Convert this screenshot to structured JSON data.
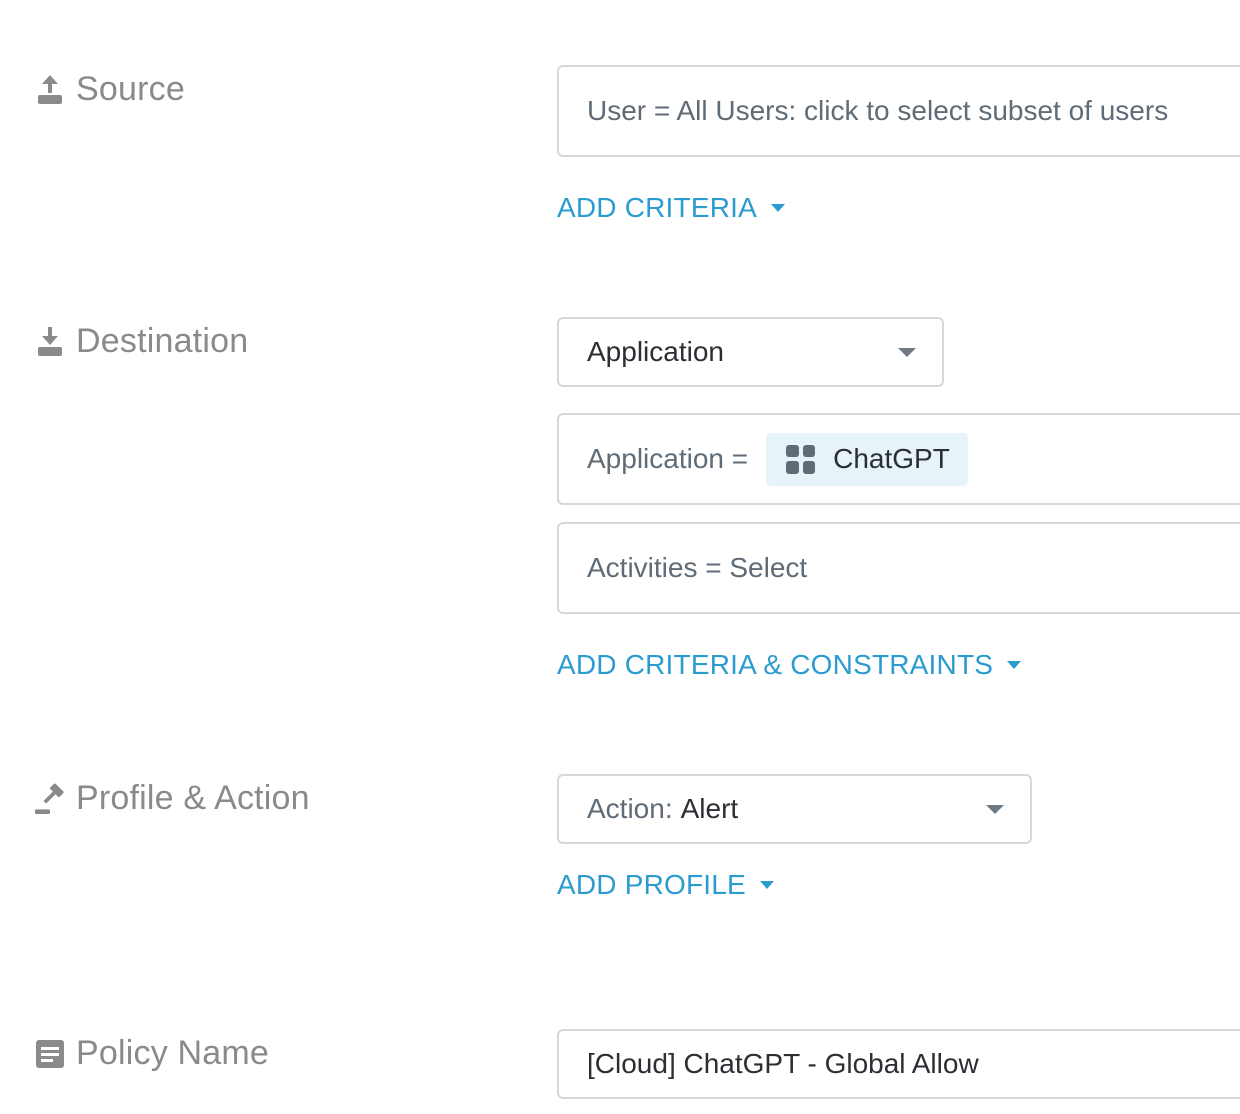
{
  "source": {
    "label": "Source",
    "icon": "upload-icon",
    "user_criteria": "User = All Users: click to select subset of users",
    "add_criteria": "ADD CRITERIA"
  },
  "destination": {
    "label": "Destination",
    "icon": "download-icon",
    "type_select": "Application",
    "application_prefix": "Application =",
    "application_chip": "ChatGPT",
    "application_chip_icon": "app-grid-icon",
    "activities": "Activities = Select",
    "add_criteria_constraints": "ADD CRITERIA & CONSTRAINTS"
  },
  "profile_action": {
    "label": "Profile & Action",
    "icon": "gavel-icon",
    "action_prefix": "Action:",
    "action_value": "Alert",
    "add_profile": "ADD PROFILE"
  },
  "policy_name": {
    "label": "Policy Name",
    "icon": "document-icon",
    "value": "[Cloud] ChatGPT - Global Allow"
  },
  "colors": {
    "label_gray": "#8a8a8a",
    "link_blue": "#2b9bd0",
    "border": "#d5d8dc",
    "chip_bg": "#e6f3f8"
  }
}
